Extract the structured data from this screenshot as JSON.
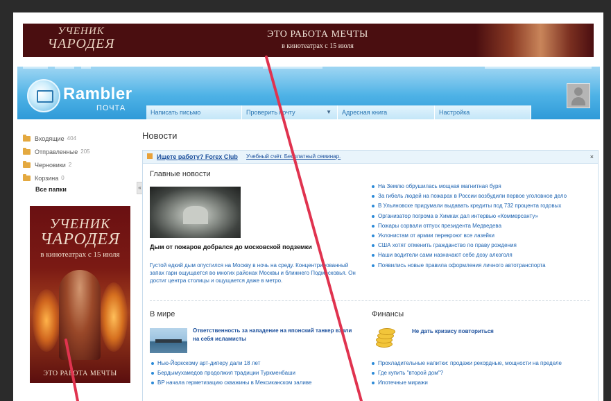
{
  "top_banner": {
    "logo_line1": "УЧЕНИК",
    "logo_line2": "ЧАРОДЕЯ",
    "slogan": "ЭТО РАБОТА МЕЧТЫ",
    "subline": "в кинотеатрах с 15 июля"
  },
  "header": {
    "brand": "Rambler",
    "product": "ПОЧТА",
    "nav": [
      {
        "label": "Написать письмо"
      },
      {
        "label": "Проверить почту"
      },
      {
        "label": "Адресная книга"
      },
      {
        "label": "Настройка"
      }
    ]
  },
  "sidebar": {
    "folders": [
      {
        "name": "Входящие",
        "count": "404"
      },
      {
        "name": "Отправленные",
        "count": "205"
      },
      {
        "name": "Черновики",
        "count": "2"
      },
      {
        "name": "Корзина",
        "count": "0"
      }
    ],
    "all_folders": "Все папки",
    "collapse_glyph": "«"
  },
  "side_banner": {
    "logo_line1": "УЧЕНИК",
    "logo_line2": "ЧАРОДЕЯ",
    "date": "в кинотеатрах с 15 июля",
    "footer": "ЭТО РАБОТА МЕЧТЫ"
  },
  "main": {
    "page_title": "Новости",
    "ad": {
      "title": "Ищете работу? Forex Club",
      "text": "Учебный счёт. Бесплатный семинар.",
      "close": "×"
    },
    "top_news": {
      "title": "Главные новости",
      "headline": "Дым от пожаров добрался до московской подземки",
      "lead": "Густой едкий дым опустился на Москву в ночь на среду. Концентрированный запах гари ощущается во многих районах Москвы и ближнего Подмосковья. Он достиг центра столицы и ощущается даже в метро.",
      "items": [
        "На Землю обрушилась мощная магнитная буря",
        "За гибель людей на пожарах в России возбудили первое уголовное дело",
        "В Ульяновске придумали выдавать кредиты под 732 процента годовых",
        "Организатор погрома в Химках дал интервью «Коммерсанту»",
        "Пожары сорвали отпуск президента Медведева",
        "Уклонистам от армии перекроют все лазейки",
        "США хотят отменить гражданство по праву рождения",
        "Наши водители сами назначают себе дозу алкоголя",
        "Появились новые правила оформления личного автотранспорта"
      ]
    },
    "world": {
      "title": "В мире",
      "headline": "Ответственность за нападение на японский танкер взяли на себя исламисты",
      "items": [
        "Нью-Йоркскому арт-диперу дали 18 лет",
        "Бердымухамедов продолжил традиции Туркменбаши",
        "BP начала герметизацию скважины в Мексиканском заливе"
      ]
    },
    "finance": {
      "title": "Финансы",
      "headline": "Не дать кризису повториться",
      "items": [
        "Прохладительные напитки: продажи рекордные, мощности на пределе",
        "Где купить \"второй дом\"?",
        "Ипотечные миражи"
      ]
    }
  },
  "colors": {
    "annotation_line": "#e0334f",
    "link": "#1b62b0",
    "header_blue": "#4eb2e6",
    "banner_dark": "#4a0e10"
  }
}
